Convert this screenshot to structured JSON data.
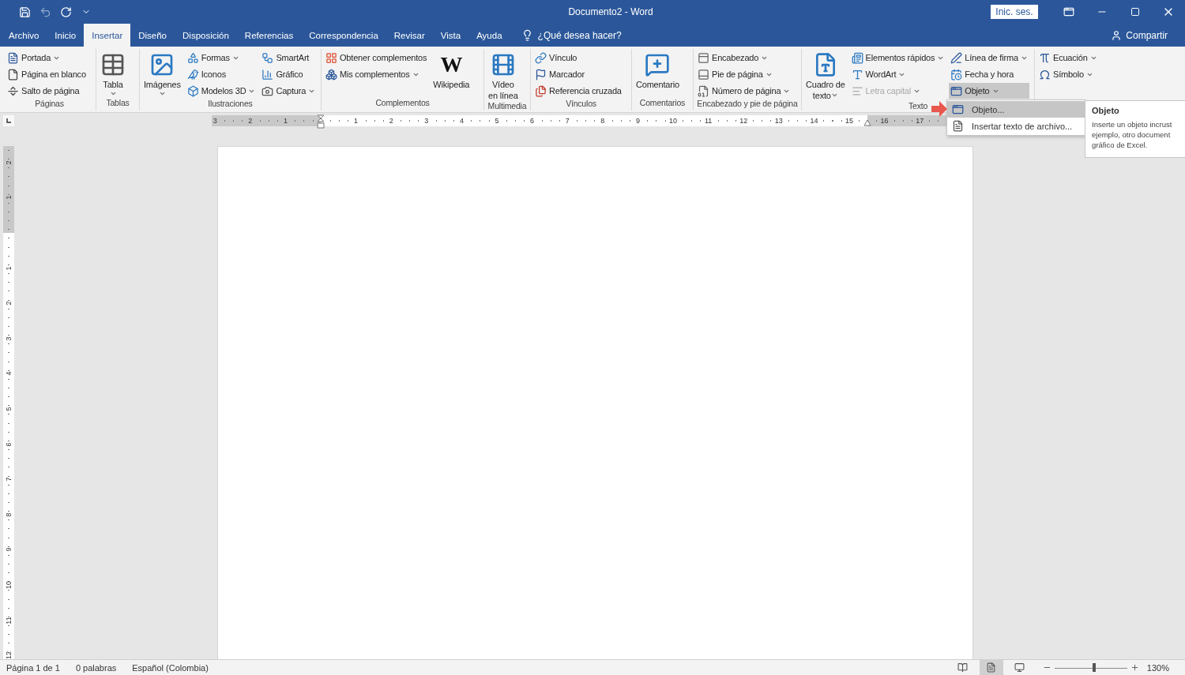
{
  "window": {
    "title": "Documento2 - Word",
    "sign_in": "Inic. ses."
  },
  "tabs": [
    {
      "label": "Archivo",
      "selected": false
    },
    {
      "label": "Inicio",
      "selected": false
    },
    {
      "label": "Insertar",
      "selected": true
    },
    {
      "label": "Diseño",
      "selected": false
    },
    {
      "label": "Disposición",
      "selected": false
    },
    {
      "label": "Referencias",
      "selected": false
    },
    {
      "label": "Correspondencia",
      "selected": false
    },
    {
      "label": "Revisar",
      "selected": false
    },
    {
      "label": "Vista",
      "selected": false
    },
    {
      "label": "Ayuda",
      "selected": false
    }
  ],
  "tell_me": "¿Qué desea hacer?",
  "share": "Compartir",
  "ribbon": {
    "groups": [
      {
        "label": "Páginas",
        "columns": [
          {
            "kind": "stack",
            "items": [
              {
                "label": "Portada",
                "caret": true,
                "disabled": false,
                "pressed": false
              },
              {
                "label": "Página en blanco",
                "caret": false,
                "disabled": false,
                "pressed": false
              },
              {
                "label": "Salto de página",
                "caret": false,
                "disabled": false,
                "pressed": false
              }
            ]
          }
        ]
      },
      {
        "label": "Tablas",
        "columns": [
          {
            "kind": "large",
            "items": [
              {
                "lines": [
                  "Tabla"
                ],
                "caret": true
              }
            ]
          }
        ]
      },
      {
        "label": "Ilustraciones",
        "columns": [
          {
            "kind": "large",
            "items": [
              {
                "lines": [
                  "Imágenes"
                ],
                "caret": true
              }
            ]
          },
          {
            "kind": "stack",
            "items": [
              {
                "label": "Formas",
                "caret": true,
                "disabled": false,
                "pressed": false
              },
              {
                "label": "Iconos",
                "caret": false,
                "disabled": false,
                "pressed": false
              },
              {
                "label": "Modelos 3D",
                "caret": true,
                "disabled": false,
                "pressed": false
              }
            ]
          },
          {
            "kind": "stack",
            "items": [
              {
                "label": "SmartArt",
                "caret": false,
                "disabled": false,
                "pressed": false
              },
              {
                "label": "Gráfico",
                "caret": false,
                "disabled": false,
                "pressed": false
              },
              {
                "label": "Captura",
                "caret": true,
                "disabled": false,
                "pressed": false
              }
            ]
          }
        ]
      },
      {
        "label": "Complementos",
        "columns": [
          {
            "kind": "stack",
            "items": [
              {
                "label": "Obtener complementos",
                "caret": false,
                "disabled": false,
                "pressed": false
              },
              {
                "label": "Mis complementos",
                "caret": true,
                "disabled": false,
                "pressed": false
              }
            ]
          },
          {
            "kind": "large",
            "items": [
              {
                "lines": [
                  "Wikipedia"
                ],
                "caret": false,
                "logo": "W"
              }
            ]
          }
        ]
      },
      {
        "label": "Multimedia",
        "columns": [
          {
            "kind": "large",
            "items": [
              {
                "lines": [
                  "Vídeo",
                  "en línea"
                ],
                "caret": false
              }
            ]
          }
        ]
      },
      {
        "label": "Vínculos",
        "columns": [
          {
            "kind": "stack",
            "items": [
              {
                "label": "Vínculo",
                "caret": false,
                "disabled": false,
                "pressed": false
              },
              {
                "label": "Marcador",
                "caret": false,
                "disabled": false,
                "pressed": false
              },
              {
                "label": "Referencia cruzada",
                "caret": false,
                "disabled": false,
                "pressed": false
              }
            ]
          }
        ]
      },
      {
        "label": "Comentarios",
        "columns": [
          {
            "kind": "large",
            "items": [
              {
                "lines": [
                  "Comentario"
                ],
                "caret": false
              }
            ]
          }
        ]
      },
      {
        "label": "Encabezado y pie de página",
        "columns": [
          {
            "kind": "stack",
            "items": [
              {
                "label": "Encabezado",
                "caret": true,
                "disabled": false,
                "pressed": false
              },
              {
                "label": "Pie de página",
                "caret": true,
                "disabled": false,
                "pressed": false
              },
              {
                "label": "Número de página",
                "caret": true,
                "disabled": false,
                "pressed": false
              }
            ]
          }
        ]
      },
      {
        "label": "Texto",
        "columns": [
          {
            "kind": "large",
            "items": [
              {
                "lines": [
                  "Cuadro de",
                  "texto"
                ],
                "caret": true
              }
            ]
          },
          {
            "kind": "stack",
            "items": [
              {
                "label": "Elementos rápidos",
                "caret": true,
                "disabled": false,
                "pressed": false
              },
              {
                "label": "WordArt",
                "caret": true,
                "disabled": false,
                "pressed": false
              },
              {
                "label": "Letra capital",
                "caret": true,
                "disabled": true,
                "pressed": false
              }
            ]
          },
          {
            "kind": "stack",
            "items": [
              {
                "label": "Línea de firma",
                "caret": true,
                "disabled": false,
                "pressed": false
              },
              {
                "label": "Fecha y hora",
                "caret": false,
                "disabled": false,
                "pressed": false
              },
              {
                "label": "Objeto",
                "caret": true,
                "disabled": false,
                "pressed": true
              }
            ]
          }
        ]
      },
      {
        "columns": [
          {
            "kind": "stack",
            "items": [
              {
                "label": "Ecuación",
                "caret": true,
                "disabled": false,
                "pressed": false
              },
              {
                "label": "Símbolo",
                "caret": true,
                "disabled": false,
                "pressed": false
              }
            ]
          }
        ]
      }
    ]
  },
  "ruler": {
    "left_numbers": [
      "3",
      "2",
      "1"
    ],
    "numbers": [
      "1",
      "2",
      "3",
      "4",
      "5",
      "6",
      "7",
      "8",
      "9",
      "10",
      "11",
      "12",
      "13",
      "14",
      "15",
      "16",
      "17"
    ]
  },
  "vertical_ruler": {
    "top_numbers": [
      "2",
      "1"
    ],
    "numbers": [
      "1",
      "2",
      "3",
      "4",
      "5",
      "6",
      "7",
      "8",
      "9",
      "10",
      "11",
      "12"
    ]
  },
  "menu": {
    "items": [
      {
        "label": "Objeto...",
        "selected": true
      },
      {
        "label": "Insertar texto de archivo...",
        "selected": false
      }
    ]
  },
  "tooltip": {
    "title": "Objeto",
    "lines": [
      "Inserte un objeto incrust",
      "ejemplo, otro document",
      "gráfico de Excel."
    ]
  },
  "status_bar": {
    "items": [
      "Página 1 de 1",
      "0 palabras",
      "Español (Colombia)"
    ],
    "views": [
      {
        "selected": false
      },
      {
        "selected": true
      },
      {
        "selected": false
      }
    ],
    "zoom": {
      "level": 0.54,
      "reading": "130%"
    }
  }
}
